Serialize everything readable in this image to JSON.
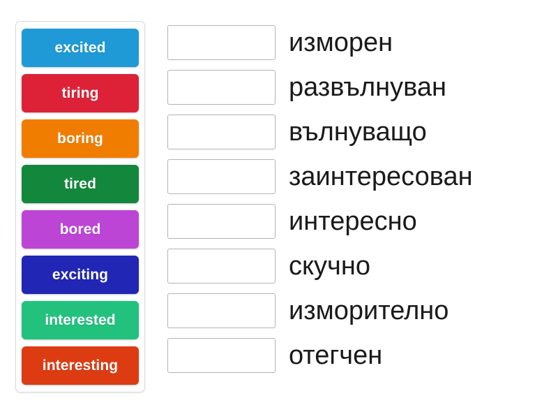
{
  "activity": {
    "type": "match-up-drag-and-drop",
    "background_color": "#ffffff"
  },
  "tile_bank": {
    "label": "word-tiles",
    "tiles": [
      {
        "text": "excited",
        "color": "#1f9ad6"
      },
      {
        "text": "tiring",
        "color": "#dd2238"
      },
      {
        "text": "boring",
        "color": "#f17d00"
      },
      {
        "text": "tired",
        "color": "#13873b"
      },
      {
        "text": "bored",
        "color": "#bc45d6"
      },
      {
        "text": "exciting",
        "color": "#2126b5"
      },
      {
        "text": "interested",
        "color": "#23c17e"
      },
      {
        "text": "interesting",
        "color": "#dd3c12"
      }
    ]
  },
  "answers": {
    "drop_zone_placeholder": "",
    "rows": [
      {
        "label": "изморен"
      },
      {
        "label": "развълнуван"
      },
      {
        "label": "вълнуващо"
      },
      {
        "label": "заинтересован"
      },
      {
        "label": "интересно"
      },
      {
        "label": "скучно"
      },
      {
        "label": "изморително"
      },
      {
        "label": "отегчен"
      }
    ]
  }
}
